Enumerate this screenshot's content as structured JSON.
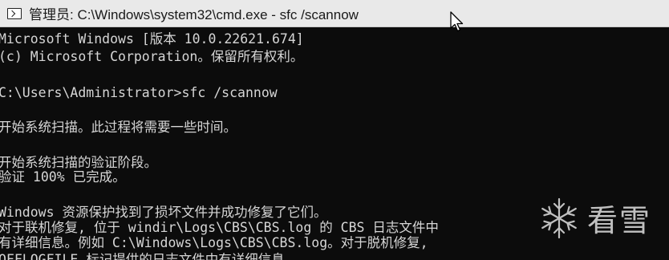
{
  "window": {
    "title": "管理员: C:\\Windows\\system32\\cmd.exe - sfc  /scannow"
  },
  "console": {
    "lines": [
      "Microsoft Windows [版本 10.0.22621.674]",
      "(c) Microsoft Corporation。保留所有权利。",
      "C:\\Users\\Administrator>sfc /scannow",
      "开始系统扫描。此过程将需要一些时间。",
      "开始系统扫描的验证阶段。",
      "验证 100% 已完成。",
      "Windows 资源保护找到了损坏文件并成功修复了它们。",
      "对于联机修复, 位于 windir\\Logs\\CBS\\CBS.log 的 CBS 日志文件中",
      "有详细信息。例如 C:\\Windows\\Logs\\CBS\\CBS.log。对于脱机修复,",
      "OFFLOGFILE 标记提供的日志文件中有详细信息。"
    ]
  },
  "watermark": {
    "text": "看雪",
    "icon": "snowflake-icon"
  },
  "colors": {
    "console_bg": "#0c0c0c",
    "console_fg": "#d6d6d6",
    "titlebar_bg": "#e9e9e9"
  }
}
